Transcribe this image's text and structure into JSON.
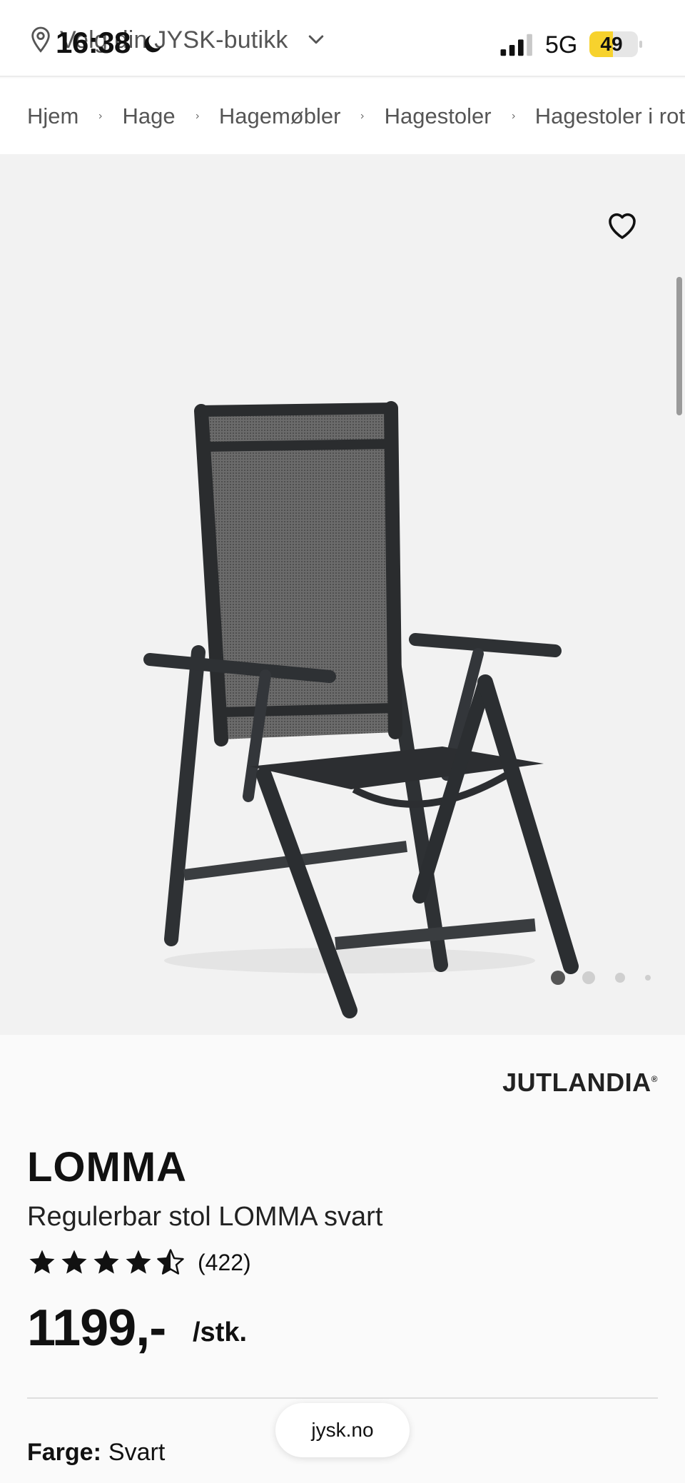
{
  "status_bar": {
    "time": "16:38",
    "network": "5G",
    "battery": "49",
    "battery_level": 0.49
  },
  "store_selector": {
    "label": "Velg din JYSK-butikk"
  },
  "breadcrumb": [
    "Hjem",
    "Hage",
    "Hagemøbler",
    "Hagestoler",
    "Hagestoler i rot"
  ],
  "gallery": {
    "image_count": 4,
    "active_index": 0
  },
  "product": {
    "brand": "JUTLANDIA",
    "brand_mark": "®",
    "title": "LOMMA",
    "subtitle": "Regulerbar stol LOMMA svart",
    "rating": 4.5,
    "review_count": "(422)",
    "price": "1199,-",
    "unit": "/stk.",
    "color_label": "Farge:",
    "color_value": "Svart"
  },
  "browser": {
    "url": "jysk.no"
  },
  "icons": {
    "location": "location-pin-icon",
    "dropdown": "chevron-down-icon",
    "favorite": "heart-icon",
    "breadcrumb_separator": "chevron-right-icon"
  },
  "colors": {
    "battery_fill": "#f7d22d",
    "text_primary": "#111111",
    "text_secondary": "#555555",
    "gallery_bg": "#f2f2f2"
  }
}
